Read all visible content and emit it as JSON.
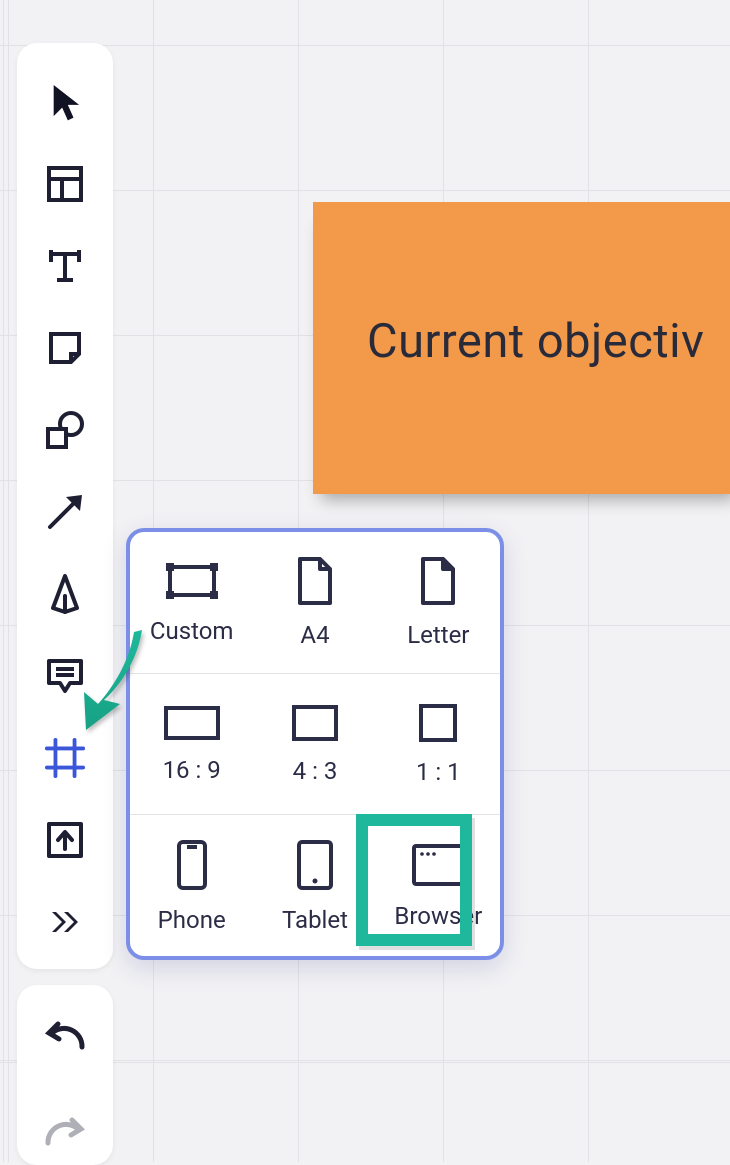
{
  "canvas": {
    "sticky_text": "Current objectiv"
  },
  "toolbar": {
    "tools": [
      {
        "name": "select"
      },
      {
        "name": "container"
      },
      {
        "name": "text"
      },
      {
        "name": "note"
      },
      {
        "name": "shape"
      },
      {
        "name": "arrow"
      },
      {
        "name": "pen"
      },
      {
        "name": "comment"
      },
      {
        "name": "frame"
      },
      {
        "name": "upload"
      },
      {
        "name": "more"
      }
    ]
  },
  "history": {
    "undo": "undo",
    "redo": "redo"
  },
  "frame_popover": {
    "rows": [
      [
        {
          "id": "custom",
          "label": "Custom"
        },
        {
          "id": "a4",
          "label": "A4"
        },
        {
          "id": "letter",
          "label": "Letter"
        }
      ],
      [
        {
          "id": "r16_9",
          "label": "16 : 9"
        },
        {
          "id": "r4_3",
          "label": "4 : 3"
        },
        {
          "id": "r1_1",
          "label": "1 : 1"
        }
      ],
      [
        {
          "id": "phone",
          "label": "Phone"
        },
        {
          "id": "tablet",
          "label": "Tablet"
        },
        {
          "id": "browser",
          "label": "Browser"
        }
      ]
    ],
    "highlighted": "browser"
  },
  "colors": {
    "ink": "#1e1f33",
    "accent": "#3b56d9",
    "popover_border": "#7c8fe8",
    "highlight": "#1fb89c",
    "sticky": "#f2994a"
  }
}
